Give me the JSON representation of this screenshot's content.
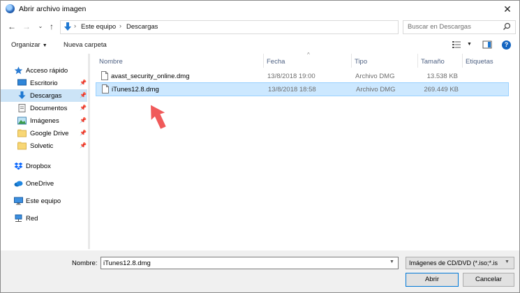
{
  "window": {
    "title": "Abrir archivo imagen",
    "close_glyph": "✕"
  },
  "address": {
    "crumbs": [
      "Este equipo",
      "Descargas"
    ],
    "separator": "›"
  },
  "search": {
    "placeholder": "Buscar en Descargas"
  },
  "toolbar": {
    "organize_label": "Organizar",
    "new_folder_label": "Nueva carpeta"
  },
  "sidebar": {
    "quick_access": "Acceso rápido",
    "items": [
      {
        "label": "Escritorio",
        "icon": "desktop-icon",
        "pinned": true
      },
      {
        "label": "Descargas",
        "icon": "download-icon",
        "pinned": true,
        "selected": true
      },
      {
        "label": "Documentos",
        "icon": "documents-icon",
        "pinned": true
      },
      {
        "label": "Imágenes",
        "icon": "pictures-icon",
        "pinned": true
      },
      {
        "label": "Google Drive",
        "icon": "folder-icon",
        "pinned": true
      },
      {
        "label": "Solvetic",
        "icon": "folder-icon",
        "pinned": true
      }
    ],
    "dropbox": "Dropbox",
    "onedrive": "OneDrive",
    "this_pc": "Este equipo",
    "network": "Red"
  },
  "columns": {
    "name": "Nombre",
    "date": "Fecha",
    "type": "Tipo",
    "size": "Tamaño",
    "tags": "Etiquetas"
  },
  "files": [
    {
      "name": "avast_security_online.dmg",
      "date": "13/8/2018 19:00",
      "type": "Archivo DMG",
      "size": "13.538 KB",
      "selected": false
    },
    {
      "name": "iTunes12.8.dmg",
      "date": "13/8/2018 18:58",
      "type": "Archivo DMG",
      "size": "269.449 KB",
      "selected": true
    }
  ],
  "footer": {
    "name_label": "Nombre:",
    "name_value": "iTunes12.8.dmg",
    "filter_value": "Imágenes de CD/DVD (*.iso;*.is",
    "open_label": "Abrir",
    "cancel_label": "Cancelar"
  },
  "colors": {
    "accent": "#0078d7",
    "selection": "#cce8ff",
    "arrow": "#f05a5a"
  }
}
